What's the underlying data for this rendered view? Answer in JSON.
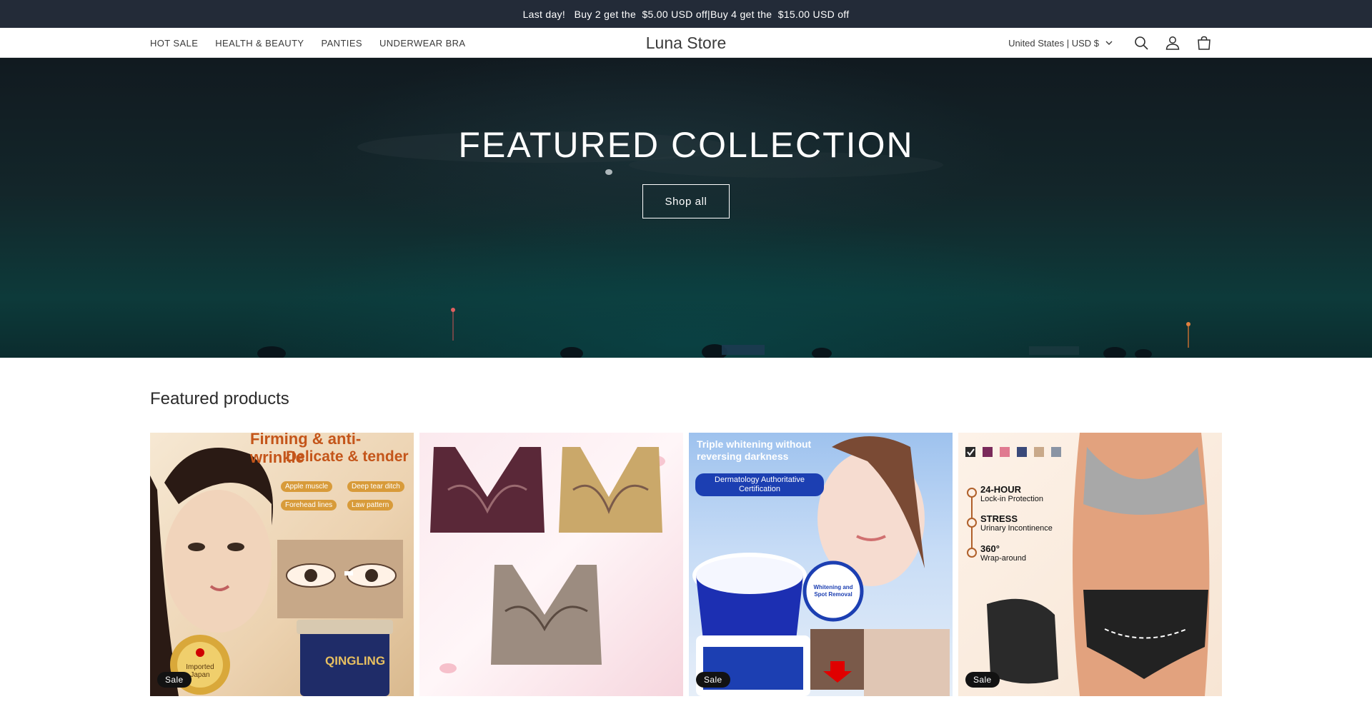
{
  "announcement": {
    "text": "Last day!   Buy 2 get the  $5.00 USD off|Buy 4 get the  $15.00 USD off"
  },
  "header": {
    "nav": [
      "HOT SALE",
      "HEALTH & BEAUTY",
      "PANTIES",
      "UNDERWEAR BRA"
    ],
    "logo": "Luna Store",
    "country": "United States | USD $",
    "icons": [
      "search-icon",
      "account-icon",
      "cart-icon"
    ]
  },
  "hero": {
    "title": "FEATURED COLLECTION",
    "button": "Shop all"
  },
  "featured": {
    "title": "Featured products",
    "products": [
      {
        "badge": "Sale",
        "texts": {
          "headline1": "Firming & anti-wrinkle",
          "headline2": "Delicate & tender",
          "tag1": "Apple muscle",
          "tag2": "Deep tear ditch",
          "tag3": "Forehead lines",
          "tag4": "Law pattern",
          "seal": "Imported Japan",
          "jar": "QINGLING"
        }
      },
      {
        "badge": ""
      },
      {
        "badge": "Sale",
        "texts": {
          "headline": "Triple whitening without reversing darkness",
          "pill": "Dermatology Authoritative Certification",
          "circle": "Whitening and Spot Removal"
        }
      },
      {
        "badge": "Sale",
        "texts": {
          "f1_title": "24-HOUR",
          "f1_sub": "Lock-in Protection",
          "f2_title": "STRESS",
          "f2_sub": "Urinary Incontinence",
          "f3_title": "360°",
          "f3_sub": "Wrap-around"
        }
      }
    ]
  },
  "colors": {
    "announcement_bg": "#232b38",
    "badge_bg": "#121212",
    "swatches": [
      "#4a2a3a",
      "#7a2a5a",
      "#e07a90",
      "#3a4a7a",
      "#c9a98a",
      "#8a94a4"
    ]
  }
}
